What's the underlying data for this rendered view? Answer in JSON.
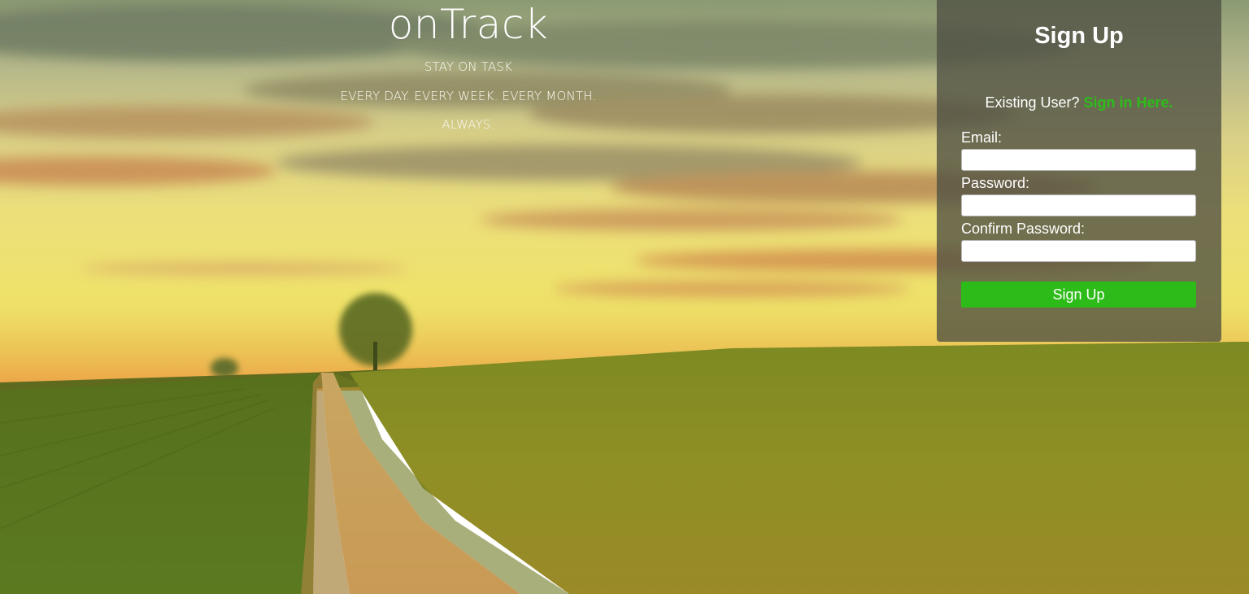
{
  "hero": {
    "brand": "onTrack",
    "lines": [
      "STAY ON TASK",
      "EVERY DAY. EVERY WEEK. EVERY MONTH.",
      "ALWAYS."
    ]
  },
  "signup": {
    "title": "Sign Up",
    "existing_prompt": "Existing User?",
    "signin_link": "Sign in Here.",
    "fields": [
      {
        "label": "Email:",
        "value": "",
        "placeholder": ""
      },
      {
        "label": "Password:",
        "value": "",
        "placeholder": ""
      },
      {
        "label": "Confirm Password:",
        "value": "",
        "placeholder": ""
      }
    ],
    "submit_label": "Sign Up"
  },
  "colors": {
    "accent": "#2dbb19",
    "panel": "#4e5042"
  }
}
